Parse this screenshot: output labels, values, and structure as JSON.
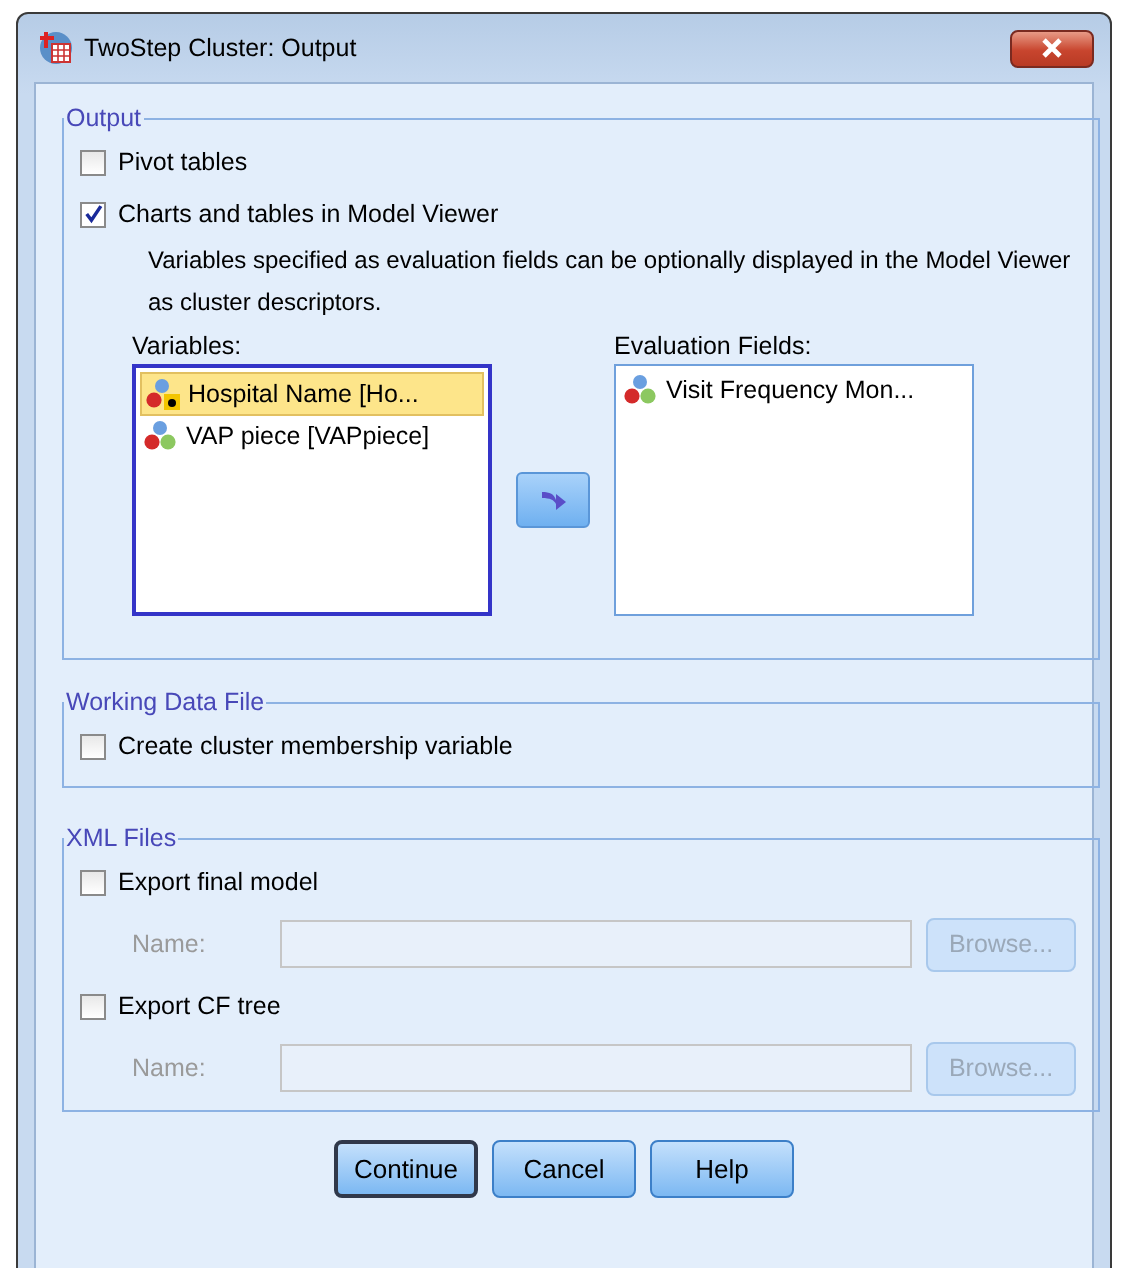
{
  "window": {
    "title": "TwoStep Cluster: Output"
  },
  "output": {
    "legend": "Output",
    "options": [
      {
        "label": "Pivot tables",
        "checked": false
      },
      {
        "label": "Charts and tables in Model Viewer",
        "checked": true
      }
    ],
    "description": "Variables specified as evaluation fields can be optionally displayed in the Model Viewer as cluster descriptors.",
    "variables": {
      "label": "Variables:",
      "items": [
        {
          "label": "Hospital Name [Ho...",
          "kind": "string",
          "selected": true
        },
        {
          "label": "VAP piece [VAPpiece]",
          "kind": "nominal",
          "selected": false
        }
      ]
    },
    "evaluation_fields": {
      "label": "Evaluation Fields:",
      "items": [
        {
          "label": "Visit Frequency Mon...",
          "kind": "nominal",
          "selected": false
        }
      ]
    }
  },
  "working_data_file": {
    "legend": "Working Data File",
    "options": [
      {
        "label": "Create cluster membership variable",
        "checked": false
      }
    ]
  },
  "xml_files": {
    "legend": "XML Files",
    "exports": [
      {
        "label": "Export final model",
        "checked": false,
        "name_label": "Name:",
        "browse": "Browse...",
        "disabled": true
      },
      {
        "label": "Export CF tree",
        "checked": false,
        "name_label": "Name:",
        "browse": "Browse...",
        "disabled": true
      }
    ]
  },
  "buttons": [
    {
      "label": "Continue",
      "default": true
    },
    {
      "label": "Cancel",
      "default": false
    },
    {
      "label": "Help",
      "default": false
    }
  ]
}
